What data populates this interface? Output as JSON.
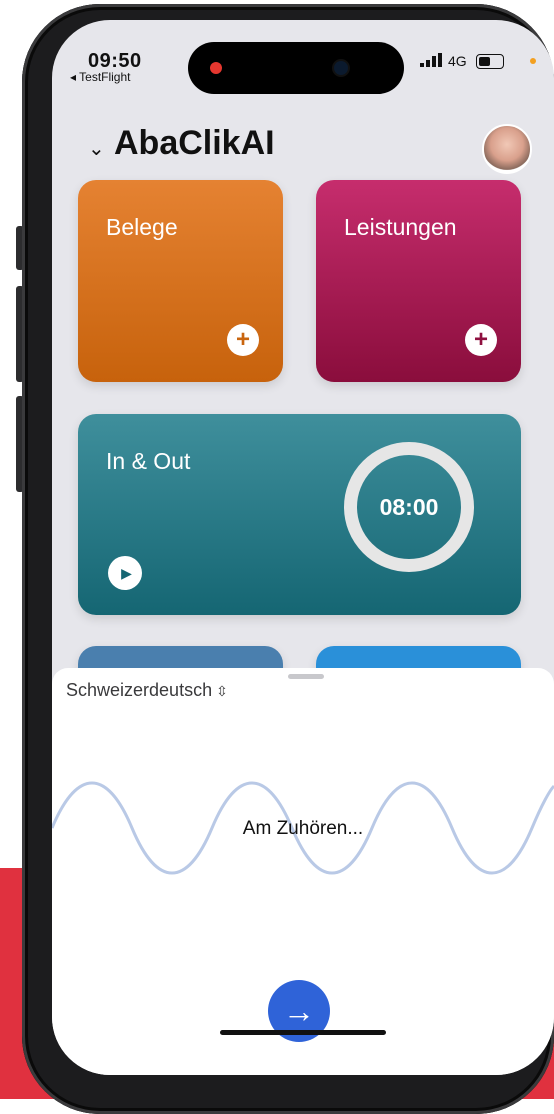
{
  "status_bar": {
    "time": "09:50",
    "back_app": "◂ TestFlight",
    "network": "4G",
    "signal_icon": "signal-bars-icon"
  },
  "header": {
    "title": "AbaClikAI",
    "chevron": "⌄"
  },
  "cards": {
    "belege": {
      "label": "Belege",
      "color": "#d56f1e"
    },
    "leistungen": {
      "label": "Leistungen",
      "color": "#a81b52"
    },
    "in_out": {
      "label": "In & Out",
      "timer": "08:00",
      "color": "#27798a"
    }
  },
  "sheet": {
    "language": "Schweizerdeutsch",
    "language_chevron": "⌃⌄",
    "status": "Am Zuhören...",
    "send_icon": "arrow-right-icon",
    "accent": "#2f63d8"
  },
  "colors": {
    "background_red": "#e0313f"
  }
}
